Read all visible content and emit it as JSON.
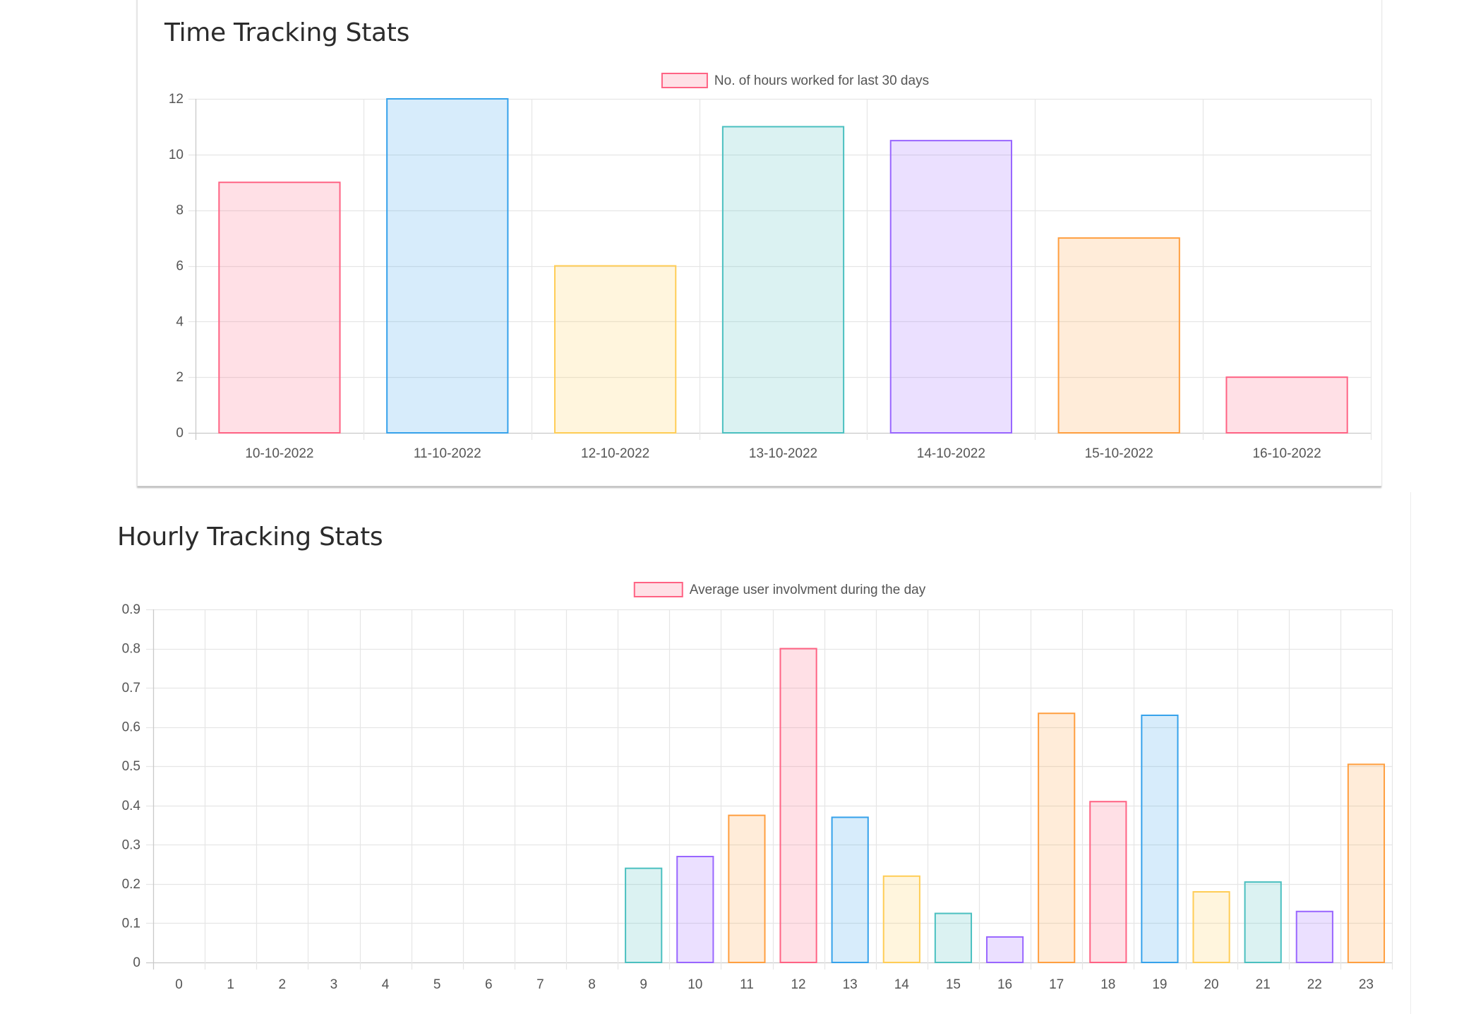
{
  "cards": [
    {
      "title": "Time Tracking Stats"
    },
    {
      "title": "Hourly Tracking Stats"
    }
  ],
  "chart_data": [
    {
      "type": "bar",
      "title": "Time Tracking Stats",
      "legend": {
        "label": "No. of hours worked for last 30 days",
        "position": "top-center",
        "color": "#ff6384"
      },
      "categories": [
        "10-10-2022",
        "11-10-2022",
        "12-10-2022",
        "13-10-2022",
        "14-10-2022",
        "15-10-2022",
        "16-10-2022"
      ],
      "series": [
        {
          "name": "No. of hours worked for last 30 days",
          "values": [
            9,
            12,
            6,
            11,
            10.5,
            7,
            2
          ]
        }
      ],
      "bar_colors": [
        "#ff6384",
        "#36a2eb",
        "#ffcd56",
        "#4bc0c0",
        "#9966ff",
        "#ff9f40",
        "#ff6384"
      ],
      "ylim": [
        0,
        12
      ],
      "yticks": [
        0,
        2,
        4,
        6,
        8,
        10,
        12
      ],
      "grid": true
    },
    {
      "type": "bar",
      "title": "Hourly Tracking Stats",
      "legend": {
        "label": "Average user involvment during the day",
        "position": "top-center",
        "color": "#ff6384"
      },
      "categories": [
        "0",
        "1",
        "2",
        "3",
        "4",
        "5",
        "6",
        "7",
        "8",
        "9",
        "10",
        "11",
        "12",
        "13",
        "14",
        "15",
        "16",
        "17",
        "18",
        "19",
        "20",
        "21",
        "22",
        "23"
      ],
      "series": [
        {
          "name": "Average user involvment during the day",
          "values": [
            0,
            0,
            0,
            0,
            0,
            0,
            0,
            0,
            0,
            0.24,
            0.27,
            0.375,
            0.8,
            0.37,
            0.22,
            0.125,
            0.065,
            0.635,
            0.41,
            0.63,
            0.18,
            0.205,
            0.13,
            0.505
          ]
        }
      ],
      "bar_colors": [
        "#ff6384",
        "#36a2eb",
        "#ffcd56",
        "#4bc0c0",
        "#9966ff",
        "#ff9f40",
        "#ff6384",
        "#36a2eb",
        "#ffcd56",
        "#4bc0c0",
        "#9966ff",
        "#ff9f40",
        "#ff6384",
        "#36a2eb",
        "#ffcd56",
        "#4bc0c0",
        "#9966ff",
        "#ff9f40",
        "#ff6384",
        "#36a2eb",
        "#ffcd56",
        "#4bc0c0",
        "#9966ff",
        "#ff9f40"
      ],
      "ylim": [
        0,
        0.9
      ],
      "yticks": [
        0,
        0.1,
        0.2,
        0.3,
        0.4,
        0.5,
        0.6,
        0.7,
        0.8,
        0.9
      ],
      "grid": true
    }
  ]
}
